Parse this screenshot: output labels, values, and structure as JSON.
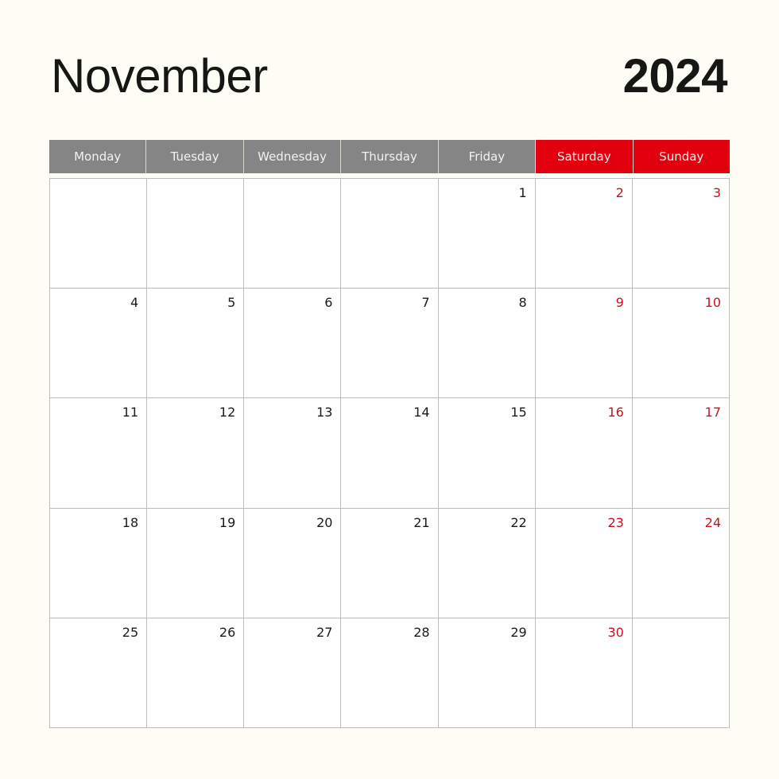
{
  "header": {
    "month": "November",
    "year": "2024"
  },
  "colors": {
    "background": "#fdfdf5",
    "weekday_header": "#858585",
    "weekend_header": "#e2000f",
    "weekend_number": "#c8101e",
    "grid_line": "#bdbdbd",
    "text": "#161614"
  },
  "weekdays": [
    {
      "label": "Monday",
      "weekend": false
    },
    {
      "label": "Tuesday",
      "weekend": false
    },
    {
      "label": "Wednesday",
      "weekend": false
    },
    {
      "label": "Thursday",
      "weekend": false
    },
    {
      "label": "Friday",
      "weekend": false
    },
    {
      "label": "Saturday",
      "weekend": true
    },
    {
      "label": "Sunday",
      "weekend": true
    }
  ],
  "weeks": [
    [
      "",
      "",
      "",
      "",
      "1",
      "2",
      "3"
    ],
    [
      "4",
      "5",
      "6",
      "7",
      "8",
      "9",
      "10"
    ],
    [
      "11",
      "12",
      "13",
      "14",
      "15",
      "16",
      "17"
    ],
    [
      "18",
      "19",
      "20",
      "21",
      "22",
      "23",
      "24"
    ],
    [
      "25",
      "26",
      "27",
      "28",
      "29",
      "30",
      ""
    ]
  ]
}
